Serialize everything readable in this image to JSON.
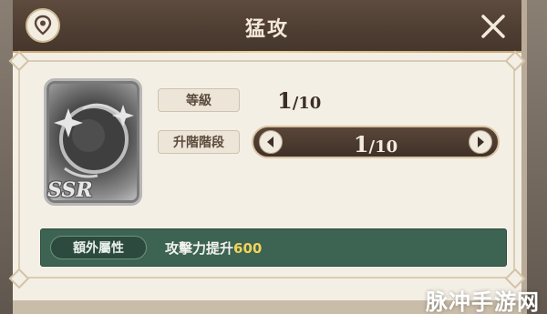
{
  "header": {
    "title": "猛攻",
    "location_icon": "location-pin-icon",
    "close_icon": "close-icon"
  },
  "card": {
    "rarity": "SSR",
    "emblem_icon": "star-orb-icon"
  },
  "level": {
    "label": "等級",
    "current": "1",
    "max": "/10"
  },
  "ascension": {
    "label": "升階階段",
    "current": "1",
    "max": "/10",
    "prev_icon": "chevron-left-icon",
    "next_icon": "chevron-right-icon"
  },
  "extra_attribute": {
    "label": "額外屬性",
    "text": "攻擊力提升",
    "value": "600"
  },
  "watermark": "脉冲手游网",
  "colors": {
    "header_bg": "#4e3d32",
    "panel_bg": "#f4efe5",
    "attr_bar": "#3d6352",
    "accent_value": "#f1d35b"
  }
}
